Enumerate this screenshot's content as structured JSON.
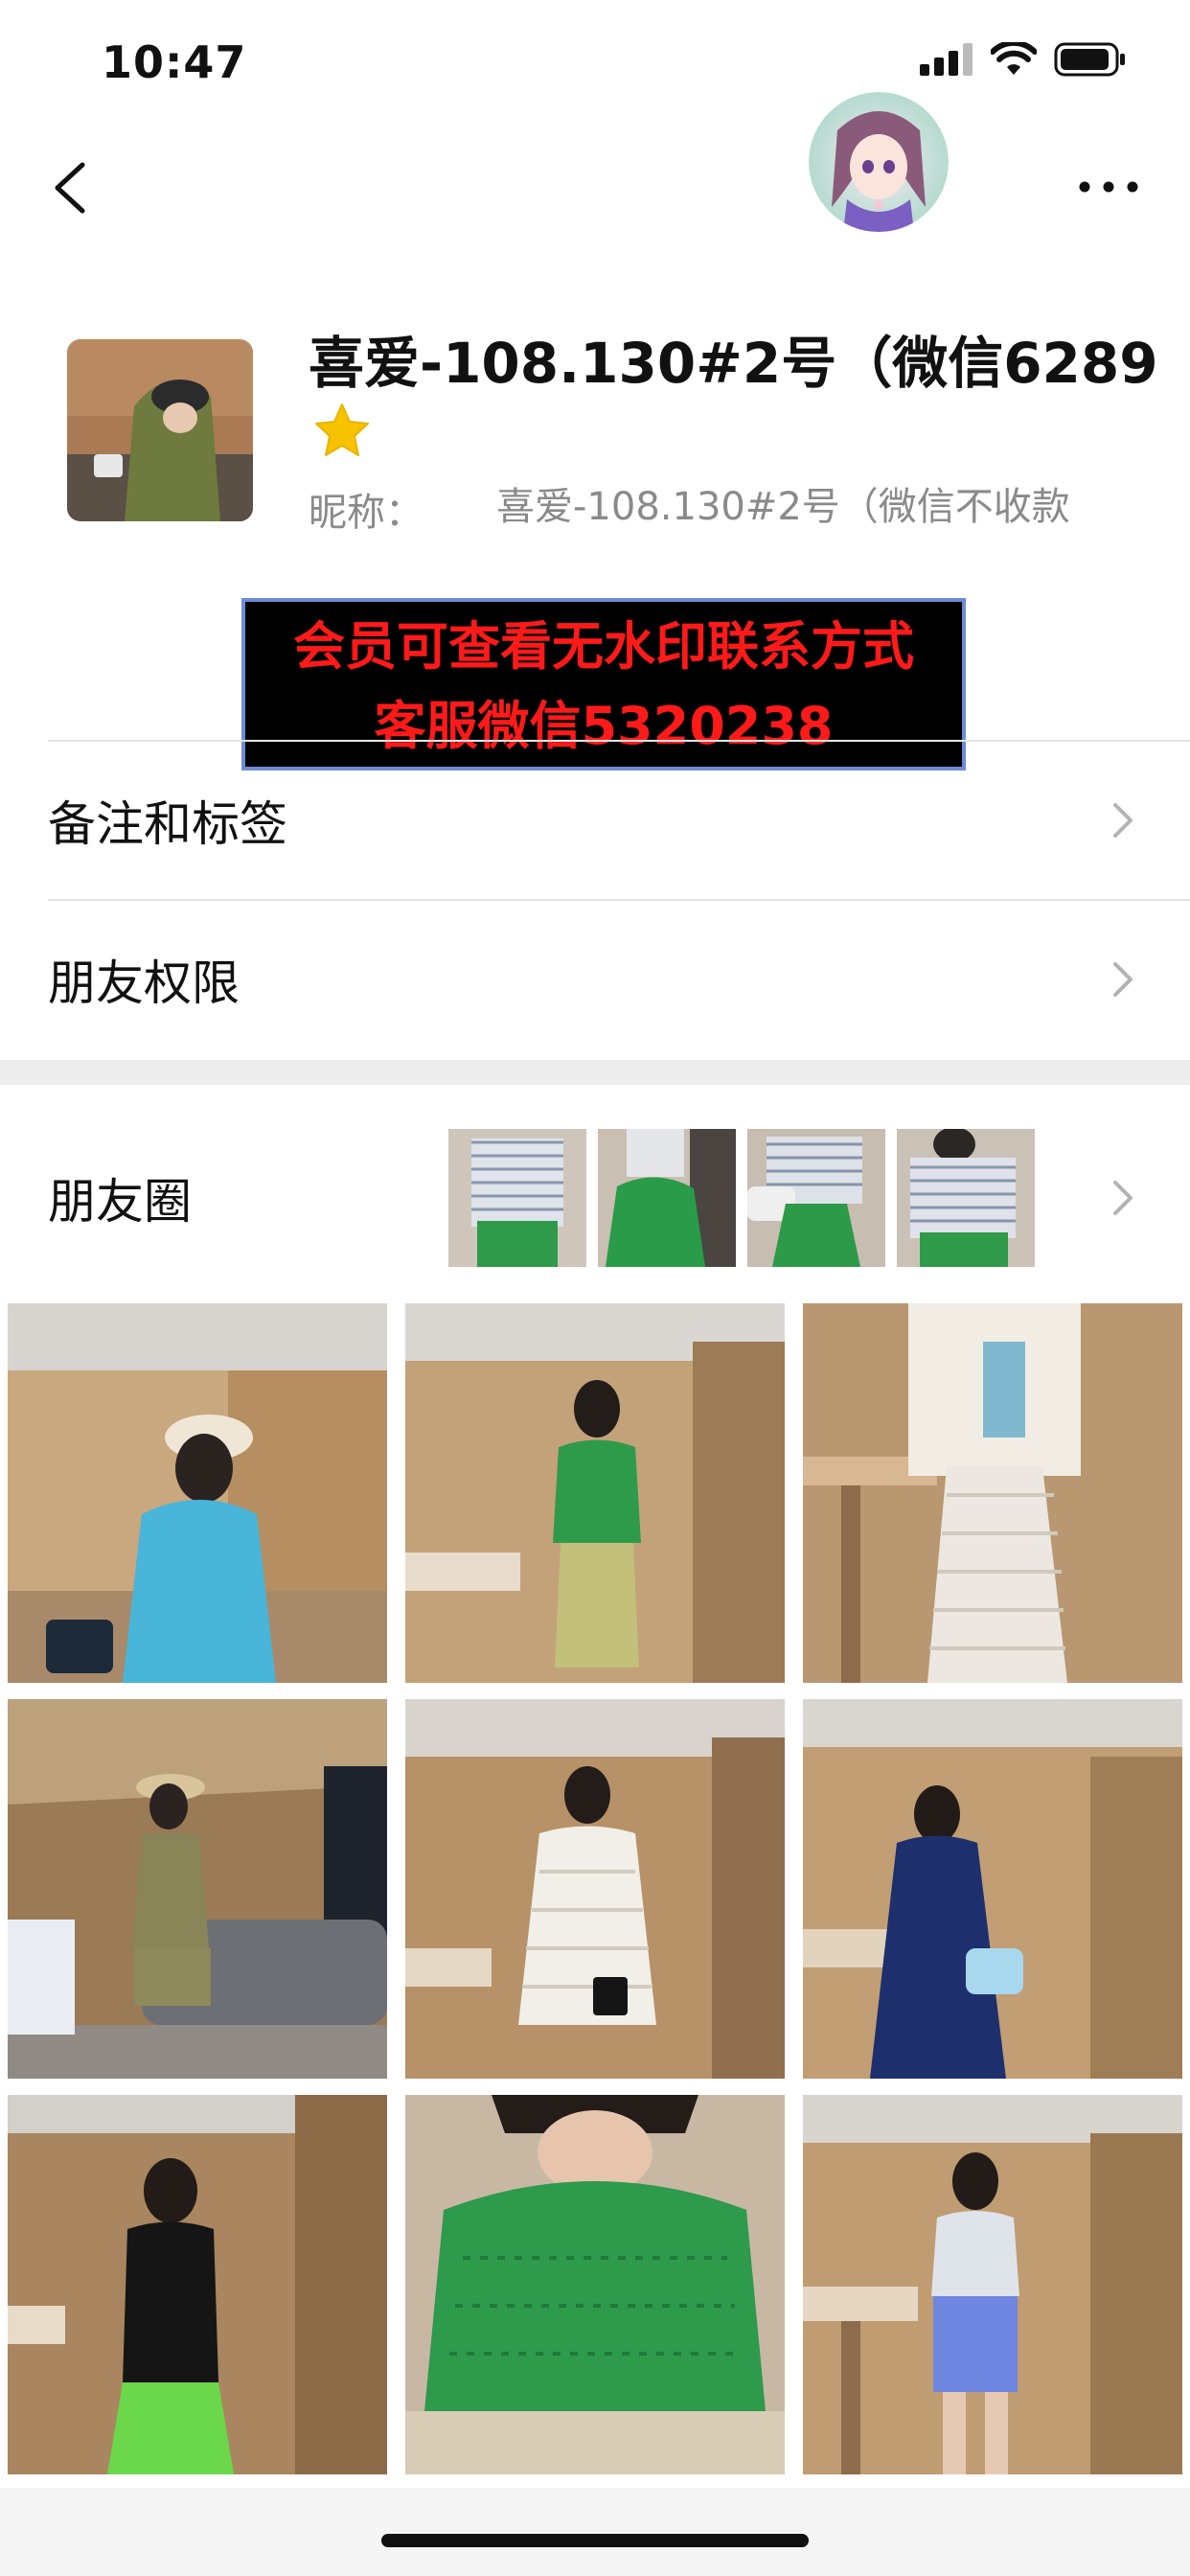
{
  "status_bar": {
    "time": "10:47"
  },
  "profile": {
    "name": "喜爱-108.130#2号（微信6289",
    "nickname_label": "昵称：",
    "nickname_value": "喜爱-108.130#2号（微信不收款"
  },
  "watermark": {
    "line1": "会员可查看无水印联系方式",
    "line2": "客服微信5320238"
  },
  "rows": {
    "remarks_label": "备注和标签",
    "permissions_label": "朋友权限",
    "moments_label": "朋友圈"
  },
  "icons": {
    "back": "chevron-left-icon",
    "more": "more-dots-icon",
    "star": "star-icon",
    "chevron": "chevron-right-icon"
  },
  "colors": {
    "watermark_text": "#ff1a1a",
    "watermark_bg": "#000000",
    "watermark_border": "#6f8bd6",
    "star": "#f7c300",
    "secondary_text": "#8a8a8a"
  },
  "photo_grid": [
    {
      "outfit": "blue shirt dress, beige cap"
    },
    {
      "outfit": "green cardigan, olive skirt"
    },
    {
      "outfit": "white crochet skirt, cream jacket"
    },
    {
      "outfit": "olive shirt and shorts, straw hat"
    },
    {
      "outfit": "white lace dress"
    },
    {
      "outfit": "navy dress, light blue bag"
    },
    {
      "outfit": "black knit top, green pants"
    },
    {
      "outfit": "green eyelet blouse"
    },
    {
      "outfit": "light top, blue shorts"
    }
  ]
}
